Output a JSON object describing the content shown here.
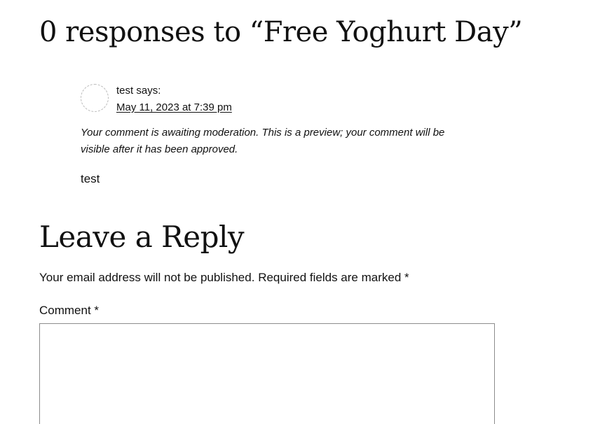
{
  "comments_section": {
    "title": "0 responses to “Free Yoghurt Day”",
    "comments": [
      {
        "author": "test",
        "says": "says:",
        "date": "May 11, 2023 at 7:39 pm",
        "moderation_notice": "Your comment is awaiting moderation. This is a preview; your comment will be visible after it has been approved.",
        "text": "test"
      }
    ]
  },
  "reply_form": {
    "title": "Leave a Reply",
    "notes": "Your email address will not be published.",
    "required_text": "Required fields are marked",
    "required_marker": "*",
    "comment_label": "Comment",
    "comment_value": ""
  }
}
